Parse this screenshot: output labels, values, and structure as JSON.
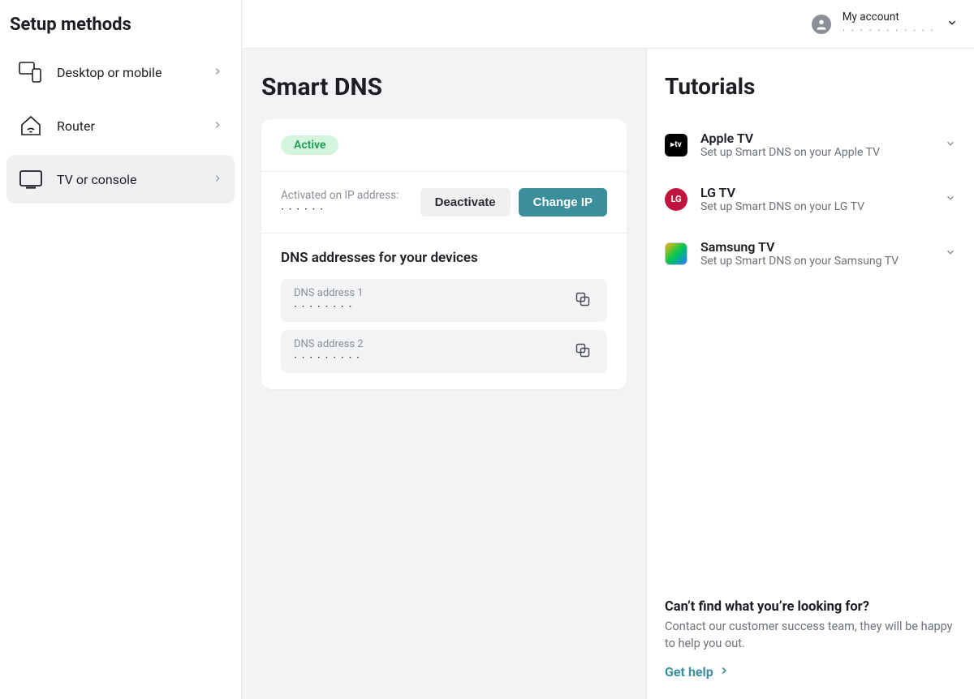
{
  "sidebar": {
    "title": "Setup methods",
    "items": [
      {
        "label": "Desktop or mobile",
        "icon": "devices-icon",
        "active": false
      },
      {
        "label": "Router",
        "icon": "home-wifi-icon",
        "active": false
      },
      {
        "label": "TV or console",
        "icon": "tv-icon",
        "active": true
      }
    ]
  },
  "header": {
    "account_label": "My account",
    "email_masked": "· · · · · · · · · · ·"
  },
  "main": {
    "title": "Smart DNS",
    "status": "Active",
    "ip_label": "Activated on IP address:",
    "ip_value": "· · ·   · · ·",
    "deactivate_label": "Deactivate",
    "change_ip_label": "Change IP",
    "dns_heading": "DNS addresses for your devices",
    "dns": [
      {
        "label": "DNS address 1",
        "value": "· · · · · · · ·"
      },
      {
        "label": "DNS address 2",
        "value": "· · · · · · · · ·"
      }
    ]
  },
  "tutorials": {
    "title": "Tutorials",
    "items": [
      {
        "title": "Apple TV",
        "desc": "Set up Smart DNS on your Apple TV",
        "icon_class": "apple",
        "icon_text": "▸tv"
      },
      {
        "title": "LG TV",
        "desc": "Set up Smart DNS on your LG TV",
        "icon_class": "lg",
        "icon_text": "LG"
      },
      {
        "title": "Samsung TV",
        "desc": "Set up Smart DNS on your Samsung TV",
        "icon_class": "samsung",
        "icon_text": ""
      }
    ]
  },
  "help": {
    "heading": "Can’t find what you’re looking for?",
    "text": "Contact our customer success team, they will be happy to help you out.",
    "link_label": "Get help"
  }
}
